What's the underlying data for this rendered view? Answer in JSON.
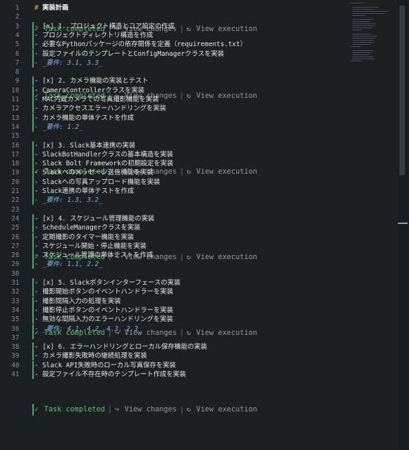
{
  "editor": {
    "heading": {
      "line": "1",
      "hash": "#",
      "text": "実装計画"
    },
    "blank_lines": [
      "2",
      "8",
      "15",
      "23",
      "30",
      "37"
    ],
    "codelens": {
      "status": "Task completed",
      "view_changes": "View changes",
      "view_execution": "View execution",
      "separator": "|"
    },
    "tasks": [
      {
        "line": "3",
        "title": "- [x] 1. プロジェクト構造とコア設定の作成",
        "items": [
          {
            "line": "4",
            "text": "- プロジェクトディレクトリ構造を作成"
          },
          {
            "line": "5",
            "text": "- 必要なPythonパッケージの依存関係を定義（requirements.txt）"
          },
          {
            "line": "6",
            "text": "- 設定ファイルのテンプレートとConfigManagerクラスを実装"
          }
        ],
        "req": {
          "line": "7",
          "text": "- _要件: 3.1, 3.3_"
        }
      },
      {
        "line": "9",
        "title": "- [x] 2. カメラ機能の実装とテスト",
        "items": [
          {
            "line": "10",
            "text": "- CameraControllerクラスを実装"
          },
          {
            "line": "11",
            "text": "- MAC内蔵カメラでの写真撮影機能を実装"
          },
          {
            "line": "12",
            "text": "- カメラアクセスエラーハンドリングを実装"
          },
          {
            "line": "13",
            "text": "- カメラ機能の単体テストを作成"
          }
        ],
        "req": {
          "line": "14",
          "text": "- _要件: 1.2_"
        }
      },
      {
        "line": "16",
        "title": "- [x] 3. Slack基本連携の実装",
        "items": [
          {
            "line": "17",
            "text": "- SlackBotHandlerクラスの基本構造を実装"
          },
          {
            "line": "18",
            "text": "- Slack Bolt Frameworkの初期設定を実装"
          },
          {
            "line": "19",
            "text": "- Slackへのメッセージ送信機能を実装"
          },
          {
            "line": "20",
            "text": "- Slackへの写真アップロード機能を実装"
          },
          {
            "line": "21",
            "text": "- Slack連携の単体テストを作成"
          }
        ],
        "req": {
          "line": "22",
          "text": "- _要件: 1.3, 3.2_"
        }
      },
      {
        "line": "24",
        "title": "- [x] 4. スケジュール管理機能の実装",
        "items": [
          {
            "line": "25",
            "text": "- ScheduleManagerクラスを実装"
          },
          {
            "line": "26",
            "text": "- 定期撮影のタイマー機能を実装"
          },
          {
            "line": "27",
            "text": "- スケジュール開始・停止機能を実装"
          },
          {
            "line": "28",
            "text": "- スケジュール管理の単体テストを作成"
          }
        ],
        "req": {
          "line": "29",
          "text": "- _要件: 1.1, 2.2_"
        }
      },
      {
        "line": "31",
        "title": "- [x] 5. Slackボタンインターフェースの実装",
        "items": [
          {
            "line": "32",
            "text": "- 撮影開始ボタンのイベントハンドラーを実装"
          },
          {
            "line": "33",
            "text": "- 撮影間隔入力の処理を実装"
          },
          {
            "line": "34",
            "text": "- 撮影停止ボタンのイベントハンドラーを実装"
          },
          {
            "line": "35",
            "text": "- 無効な間隔入力のエラーハンドリングを実装"
          }
        ],
        "req": {
          "line": "36",
          "text": "- _要件: 4.1, 4.2, 4.3, 2.3_"
        }
      },
      {
        "line": "38",
        "title": "- [x] 6. エラーハンドリングとローカル保存機能の実装",
        "items": [
          {
            "line": "39",
            "text": "- カメラ撮影失敗時の継続処理を実装"
          },
          {
            "line": "40",
            "text": "- Slack API失敗時のローカル写真保存を実装"
          },
          {
            "line": "41",
            "text": "- 設定ファイル不存在時のテンプレート作成を実装"
          }
        ],
        "req": null
      }
    ]
  },
  "icons": {
    "check": "check-icon",
    "view_changes": "diff-arrow-icon",
    "view_execution": "history-icon"
  },
  "colors": {
    "background": "#1e1f22",
    "status_green": "#58c472",
    "requirement_blue": "#7eb8ea",
    "heading_hash": "#e6b450"
  }
}
